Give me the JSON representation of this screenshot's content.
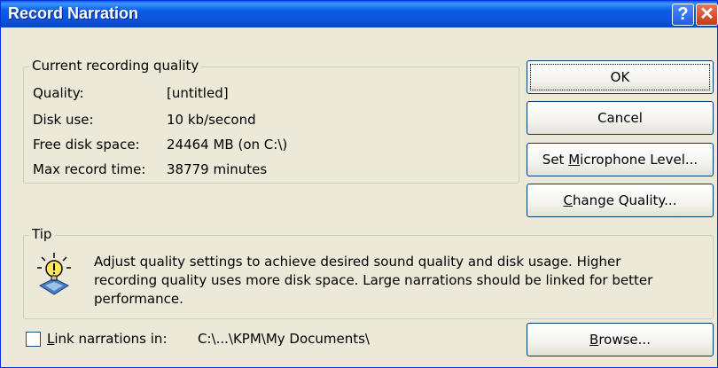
{
  "window": {
    "title": "Record Narration",
    "help_glyph": "?",
    "close_glyph": "✕"
  },
  "quality_group": {
    "label": "Current recording quality",
    "rows": [
      {
        "key": "Quality:",
        "value": "[untitled]"
      },
      {
        "key": "Disk use:",
        "value": "10 kb/second"
      },
      {
        "key": "Free disk space:",
        "value": "24464 MB (on C:\\)"
      },
      {
        "key": "Max record time:",
        "value": "38779 minutes"
      }
    ]
  },
  "buttons": {
    "ok": "OK",
    "cancel": "Cancel",
    "set_mic_prefix": "Set ",
    "set_mic_mnemonic": "M",
    "set_mic_suffix": "icrophone Level...",
    "change_quality_mnemonic": "C",
    "change_quality_suffix": "hange Quality...",
    "browse_mnemonic": "B",
    "browse_suffix": "rowse..."
  },
  "tip_group": {
    "label": "Tip",
    "icon": "lightbulb-icon",
    "text_lines": [
      "Adjust quality settings to achieve desired sound quality and disk usage. Higher",
      "recording quality uses more disk space. Large narrations should be linked for better",
      "performance."
    ]
  },
  "link": {
    "checked": false,
    "label_mnemonic": "L",
    "label_suffix": "ink narrations in:",
    "path": "C:\\...\\KPM\\My Documents\\"
  },
  "colors": {
    "titlebar": "#0a55df",
    "dialog_bg": "#ece9d8",
    "close_button": "#c9381b"
  }
}
